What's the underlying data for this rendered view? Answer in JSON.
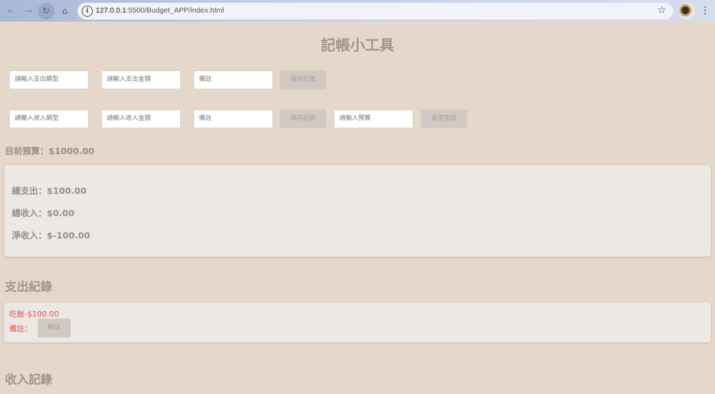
{
  "browser": {
    "url_host": "127.0.0.1",
    "url_path": ":5500/Budget_APP/index.html"
  },
  "page": {
    "title": "記帳小工具"
  },
  "expense_form": {
    "type_placeholder": "請輸入支出類型",
    "amount_placeholder": "請輸入支出金額",
    "note_placeholder": "備註",
    "save_label": "保存記錄"
  },
  "income_form": {
    "type_placeholder": "請輸入收入類型",
    "amount_placeholder": "請輸入收入金額",
    "note_placeholder": "備註",
    "save_label": "保存記錄"
  },
  "budget_form": {
    "budget_placeholder": "請輸入預算",
    "set_label": "設定完成"
  },
  "budget": {
    "current": "目前預算：$1000.00"
  },
  "summary": {
    "total_expense": "總支出：$100.00",
    "total_income": "總收入：$0.00",
    "net_income": "淨收入：$-100.00"
  },
  "expense_records": {
    "heading": "支出紀錄",
    "items": [
      {
        "title": "吃飯-$100.00",
        "note": "備註：",
        "delete_label": "刪除"
      }
    ]
  },
  "income_records": {
    "heading": "收入記錄"
  },
  "colors": {
    "background": "#e5d7ca",
    "record_text": "#e0554f",
    "panel": "#ece8e4"
  }
}
